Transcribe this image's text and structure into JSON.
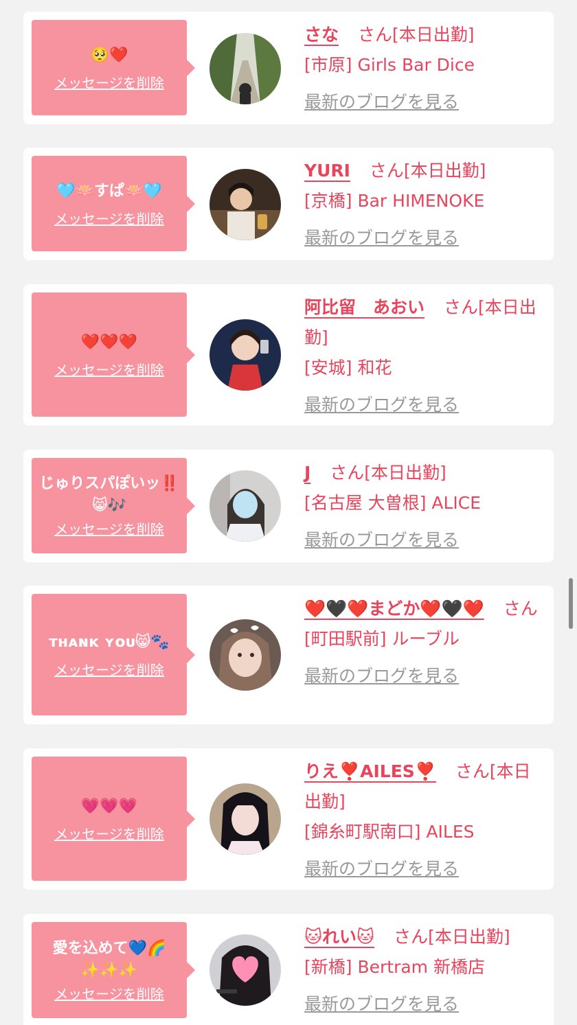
{
  "cards": [
    {
      "message": "🥺❤️",
      "delete_label": "メッセージを削除",
      "name": "さな",
      "suffix": "さん[本日出勤]",
      "store": "[市原] Girls Bar Dice",
      "blog_label": "最新のブログを見る"
    },
    {
      "message": "🩵🪷すぱ🪷🩵",
      "delete_label": "メッセージを削除",
      "name": "YURI",
      "suffix": "さん[本日出勤]",
      "store": "[京橋] Bar HIMENOKE",
      "blog_label": "最新のブログを見る"
    },
    {
      "message": "❤️❤️❤️",
      "delete_label": "メッセージを削除",
      "name": "阿比留　あおい",
      "suffix": "さん[本日出勤]",
      "store": "[安城] 和花",
      "blog_label": "最新のブログを見る"
    },
    {
      "message": "じゅりスパぽいッ‼️😸🎶",
      "delete_label": "メッセージを削除",
      "name": "J",
      "suffix": "さん[本日出勤]",
      "store": "[名古屋 大曽根] ALICE",
      "blog_label": "最新のブログを見る"
    },
    {
      "message": "ᴛʜᴀɴᴋ ʏᴏᴜ😸🐾",
      "delete_label": "メッセージを削除",
      "name": "❤️🖤❤️まどか❤️🖤❤️",
      "suffix": "さん",
      "store": "[町田駅前] ルーブル",
      "blog_label": "最新のブログを見る"
    },
    {
      "message": "💗💗💗",
      "delete_label": "メッセージを削除",
      "name": "りえ❣️AILES❣️",
      "suffix": "さん[本日出勤]",
      "store": "[錦糸町駅南口] AILES",
      "blog_label": "最新のブログを見る"
    },
    {
      "message": "愛を込めて💙🌈✨✨✨",
      "delete_label": "メッセージを削除",
      "name": "🐱れい🐱",
      "suffix": "さん[本日出勤]",
      "store": "[新橋] Bertram 新橋店",
      "blog_label": "最新のブログを見る"
    }
  ],
  "colors": {
    "bubble": "#f7929f",
    "accent": "#e8445c",
    "link_gray": "#999999",
    "background": "#f2f2f2"
  }
}
